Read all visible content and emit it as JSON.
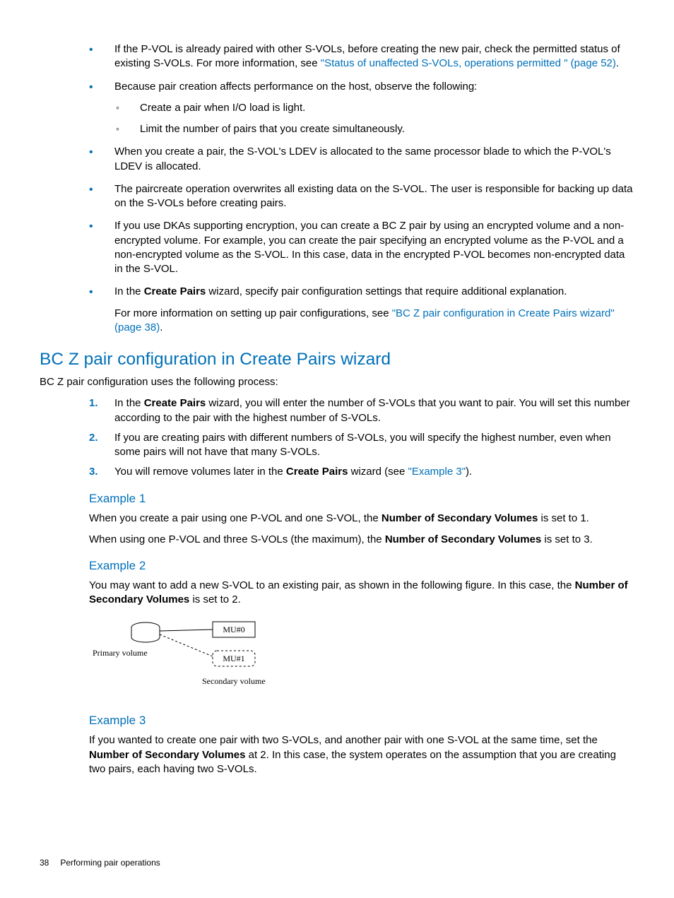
{
  "bullets": [
    {
      "pre": "If the P-VOL is already paired with other S-VOLs, before creating the new pair, check the permitted status of existing S-VOLs. For more information, see ",
      "link": "\"Status of unaffected S-VOLs, operations permitted \" (page 52)",
      "post": "."
    },
    {
      "pre": "Because pair creation affects performance on the host, observe the following:",
      "sub": [
        "Create a pair when I/O load is light.",
        "Limit the number of pairs that you create simultaneously."
      ]
    },
    {
      "pre": "When you create a pair, the S-VOL's LDEV is allocated to the same processor blade to which the P-VOL's LDEV is allocated."
    },
    {
      "pre": "The paircreate operation overwrites all existing data on the S-VOL. The user is responsible for backing up data on the S-VOLs before creating pairs."
    },
    {
      "pre": "If you use DKAs supporting encryption, you can create a BC Z pair by using an encrypted volume and a non-encrypted volume. For example, you can create the pair specifying an encrypted volume as the P-VOL and a non-encrypted volume as the S-VOL. In this case, data in the encrypted P-VOL becomes non-encrypted data in the S-VOL."
    },
    {
      "pre_a": "In the ",
      "bold_a": "Create Pairs",
      "post_a": " wizard, specify pair configuration settings that require additional explanation.",
      "extra_pre": "For more information on setting up pair configurations, see ",
      "extra_link": "\"BC Z pair configuration in Create Pairs wizard\" (page 38)",
      "extra_post": "."
    }
  ],
  "section_heading": "BC Z pair configuration in Create Pairs wizard",
  "section_intro": "BC Z pair configuration uses the following process:",
  "steps": {
    "s1_a": "In the ",
    "s1_bold": "Create Pairs",
    "s1_b": " wizard, you will enter the number of S-VOLs that you want to pair. You will set this number according to the pair with the highest number of S-VOLs.",
    "s2": "If you are creating pairs with different numbers of S-VOLs, you will specify the highest number, even when some pairs will not have that many S-VOLs.",
    "s3_a": "You will remove volumes later in the ",
    "s3_bold": "Create Pairs",
    "s3_b": " wizard (see ",
    "s3_link": "\"Example 3\"",
    "s3_c": ")."
  },
  "example1": {
    "title": "Example 1",
    "p1_a": "When you create a pair using one P-VOL and one S-VOL, the ",
    "p1_bold": "Number of Secondary Volumes",
    "p1_b": " is set to 1.",
    "p2_a": "When using one P-VOL and three S-VOLs (the maximum), the ",
    "p2_bold": "Number of Secondary Volumes",
    "p2_b": " is set to 3."
  },
  "example2": {
    "title": "Example 2",
    "p_a": "You may want to add a new S-VOL to an existing pair, as shown in the following figure. In this case, the ",
    "p_bold": "Number of Secondary Volumes",
    "p_b": " is set to 2.",
    "fig": {
      "primary": "Primary volume",
      "mu0": "MU#0",
      "mu1": "MU#1",
      "secondary": "Secondary volume"
    }
  },
  "example3": {
    "title": "Example 3",
    "p_a": "If you wanted to create one pair with two S-VOLs, and another pair with one S-VOL at the same time, set the ",
    "p_bold": "Number of Secondary Volumes",
    "p_b": " at 2. In this case, the system operates on the assumption that you are creating two pairs, each having two S-VOLs."
  },
  "footer": {
    "page": "38",
    "title": "Performing pair operations"
  },
  "nums": {
    "n1": "1.",
    "n2": "2.",
    "n3": "3."
  }
}
